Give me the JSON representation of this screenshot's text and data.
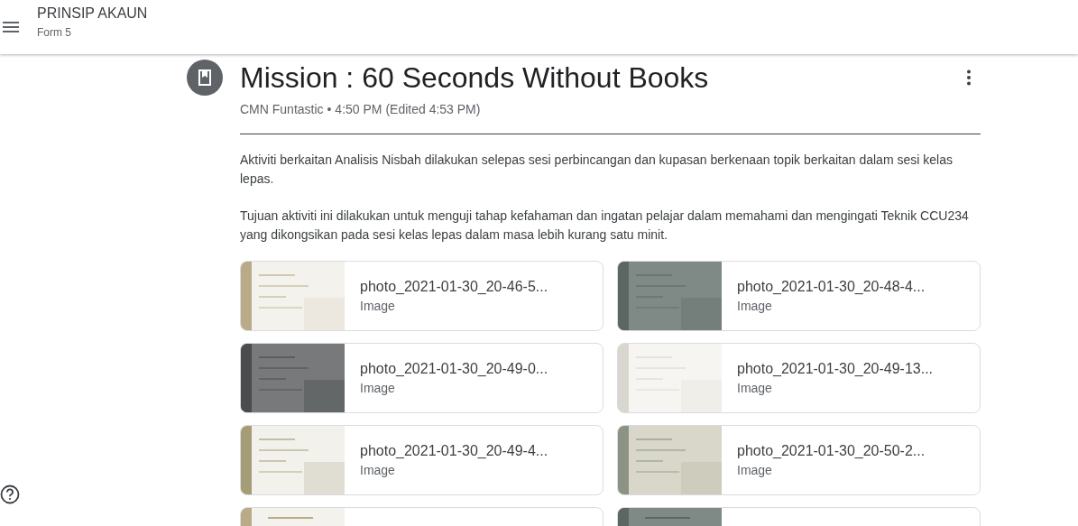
{
  "header": {
    "title": "PRINSIP AKAUN",
    "subtitle": "Form 5"
  },
  "post": {
    "title": "Mission : 60 Seconds Without Books",
    "author": "CMN Funtastic",
    "meta": "• 4:50 PM (Edited 4:53 PM)",
    "paragraphs": [
      "Aktiviti berkaitan Analisis Nisbah dilakukan selepas sesi perbincangan dan kupasan berkenaan topik berkaitan dalam sesi kelas lepas.",
      "Tujuan aktiviti ini dilakukan untuk menguji tahap kefahaman dan ingatan pelajar dalam memahami dan mengingati Teknik CCU234 yang dikongsikan pada sesi kelas lepas dalam masa lebih kurang satu minit."
    ]
  },
  "attachments": [
    {
      "kind": "file",
      "name": "photo_2021-01-30_20-46-5...",
      "type": "Image"
    },
    {
      "kind": "file",
      "name": "photo_2021-01-30_20-48-4...",
      "type": "Image"
    },
    {
      "kind": "file",
      "name": "photo_2021-01-30_20-49-0...",
      "type": "Image"
    },
    {
      "kind": "file",
      "name": "photo_2021-01-30_20-49-13...",
      "type": "Image"
    },
    {
      "kind": "file",
      "name": "photo_2021-01-30_20-49-4...",
      "type": "Image"
    },
    {
      "kind": "file",
      "name": "photo_2021-01-30_20-50-2...",
      "type": "Image"
    },
    {
      "kind": "cut"
    },
    {
      "kind": "cut"
    }
  ]
}
